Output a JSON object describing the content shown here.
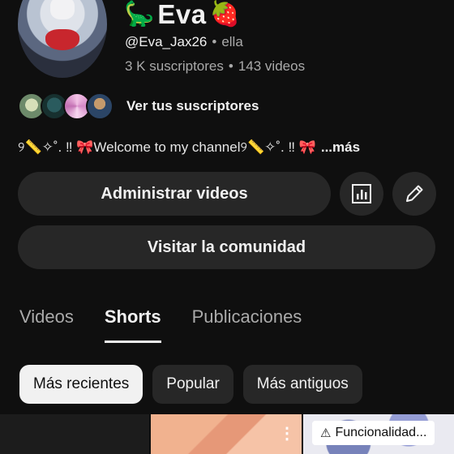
{
  "channel": {
    "emoji_left": "🦕",
    "name": "Eva",
    "emoji_right": "🍓",
    "handle": "@Eva_Jax26",
    "pronouns": "ella",
    "subscribers": "3 K suscriptores",
    "videos": "143 videos",
    "separator": "•",
    "view_subscribers": "Ver tus suscriptores",
    "description": "୨📏✧˚. ‼ 🎀Welcome to my channel୨📏✧˚. ‼ 🎀",
    "more": "...más"
  },
  "actions": {
    "manage_videos": "Administrar videos",
    "analytics_icon": "analytics-icon",
    "edit_icon": "pencil-icon",
    "visit_community": "Visitar la comunidad"
  },
  "tabs": [
    {
      "label": "Videos",
      "active": false
    },
    {
      "label": "Shorts",
      "active": true
    },
    {
      "label": "Publicaciones",
      "active": false
    }
  ],
  "chips": [
    {
      "label": "Más recientes",
      "active": true
    },
    {
      "label": "Popular",
      "active": false
    },
    {
      "label": "Más antiguos",
      "active": false
    }
  ],
  "badge": {
    "warning_icon": "warning-icon",
    "text": "Funcionalidad..."
  },
  "menu_icon": "more-vert-icon",
  "colors": {
    "background": "#0f0f0f",
    "button": "#272727",
    "text": "#f1f1f1",
    "muted": "#aaaaaa"
  }
}
